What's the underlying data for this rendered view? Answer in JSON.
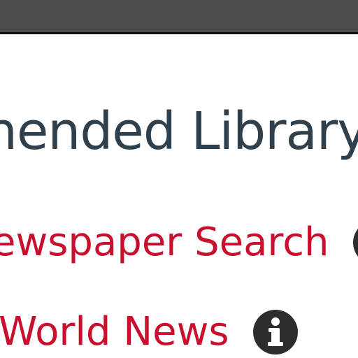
{
  "header": {
    "bar_color": "#4b4b4b"
  },
  "main": {
    "heading": "nended Library",
    "links": [
      {
        "label": "ewspaper Search",
        "icon": "info-icon"
      },
      {
        "label": "World News",
        "icon": "info-icon"
      }
    ]
  },
  "colors": {
    "heading": "#2f3f4c",
    "link": "#c8102e",
    "icon": "#2d2d2d"
  }
}
